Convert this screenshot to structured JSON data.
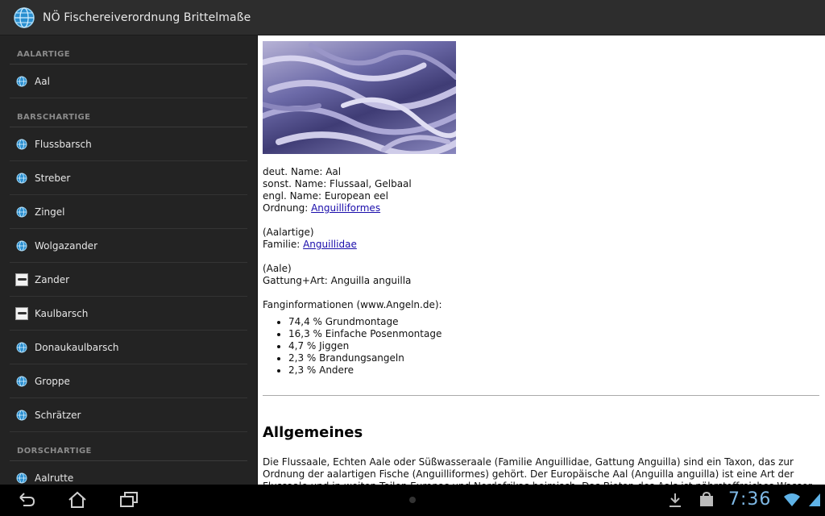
{
  "app": {
    "title": "NÖ Fischereiverordnung Brittelmaße"
  },
  "sidebar": {
    "sections": [
      {
        "header": "AALARTIGE",
        "items": [
          {
            "label": "Aal",
            "icon": "globe-icon"
          }
        ]
      },
      {
        "header": "BARSCHARTIGE",
        "items": [
          {
            "label": "Flussbarsch",
            "icon": "globe-icon"
          },
          {
            "label": "Streber",
            "icon": "globe-icon"
          },
          {
            "label": "Zingel",
            "icon": "globe-icon"
          },
          {
            "label": "Wolgazander",
            "icon": "globe-icon"
          },
          {
            "label": "Zander",
            "icon": "fish-thumbnail"
          },
          {
            "label": "Kaulbarsch",
            "icon": "fish-thumbnail"
          },
          {
            "label": "Donaukaulbarsch",
            "icon": "globe-icon"
          },
          {
            "label": "Groppe",
            "icon": "globe-icon"
          },
          {
            "label": "Schrätzer",
            "icon": "globe-icon"
          }
        ]
      },
      {
        "header": "DORSCHARTIGE",
        "items": [
          {
            "label": "Aalrutte",
            "icon": "globe-icon"
          }
        ]
      }
    ]
  },
  "content": {
    "lines": {
      "deut": "deut. Name: Aal",
      "sonst": "sonst. Name: Flussaal, Gelbaal",
      "engl": "engl. Name: European eel",
      "ordnung_prefix": "Ordnung: ",
      "ordnung_link": "Anguilliformes",
      "aalartige": "(Aalartige)",
      "familie_prefix": "Familie: ",
      "familie_link": "Anguillidae",
      "aale": "(Aale)",
      "gattung": "Gattung+Art: Anguilla anguilla",
      "fang": "Fanginformationen (www.Angeln.de):"
    },
    "fang_list": [
      "74,4 % Grundmontage",
      "16,3 % Einfache Posenmontage",
      "4,7 % Jiggen",
      "2,3 % Brandungsangeln",
      "2,3 % Andere"
    ],
    "heading": "Allgemeines",
    "paragraph": "Die Flussaale, Echten Aale oder Süßwasseraale (Familie Anguillidae, Gattung Anguilla) sind ein Taxon, das zur Ordnung der aalartigen Fische (Anguilliformes) gehört. Der Europäische Aal (Anguilla anguilla) ist eine Art der Flussaale und in weiten Teilen Europas und Nordafrikas heimisch. Das Biotop des Aals ist nährstoffreiches Wasser."
  },
  "statusbar": {
    "time": "7:36"
  },
  "colors": {
    "actionbar": "#2d2d2d",
    "sidebar": "#232323",
    "link": "#1a0dab",
    "clock": "#7fb9e6"
  }
}
